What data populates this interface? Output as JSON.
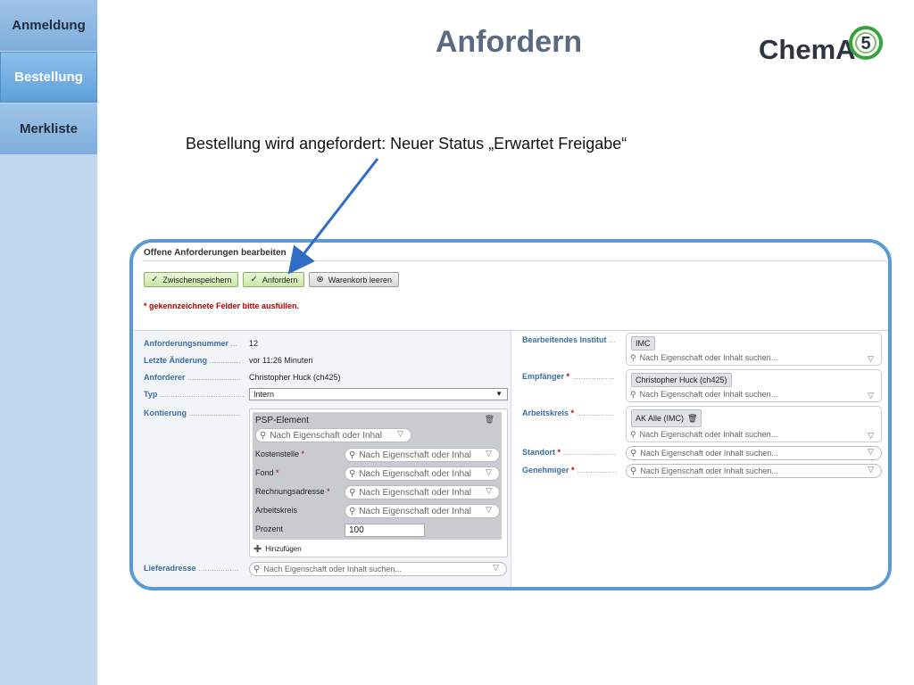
{
  "nav": {
    "items": [
      {
        "label": "Anmeldung"
      },
      {
        "label": "Bestellung"
      },
      {
        "label": "Merkliste"
      }
    ]
  },
  "slide": {
    "title": "Anfordern",
    "logo_text": "ChemA",
    "logo_number": "5",
    "caption": "Bestellung wird angefordert: Neuer Status „Erwartet Freigabe“"
  },
  "panel": {
    "title": "Offene Anforderungen bearbeiten",
    "buttons": {
      "save": "Zwischenspeichern",
      "request": "Anfordern",
      "clear_cart": "Warenkorb leeren"
    },
    "required_note": "* gekennzeichnete Felder bitte ausfüllen.",
    "left": {
      "number_label": "Anforderungsnummer",
      "number_value": "12",
      "changed_label": "Letzte Änderung",
      "changed_value": "vor 11:26 Minuten",
      "requester_label": "Anforderer",
      "requester_value": "Christopher Huck (ch425)",
      "type_label": "Typ",
      "type_value": "Intern",
      "kontierung_label": "Kontierung",
      "kontierung": {
        "psp_label": "PSP-Element",
        "kostenstelle_label": "Kostenstelle",
        "fond_label": "Fond",
        "rechnungsadresse_label": "Rechnungsadresse",
        "arbeitskreis_label": "Arbeitskreis",
        "prozent_label": "Prozent",
        "prozent_value": "100",
        "search_placeholder": "Nach Eigenschaft oder Inhal",
        "add_label": "Hinzufügen"
      },
      "delivery_label": "Lieferadresse",
      "delivery_placeholder": "Nach Eigenschaft oder Inhalt suchen..."
    },
    "right": {
      "institute_label": "Bearbeitendes Institut",
      "institute_tag": "IMC",
      "recipient_label": "Empfänger",
      "recipient_tag": "Christopher Huck (ch425)",
      "workgroup_label": "Arbeitskreis",
      "workgroup_tag": "AK Alle (IMC)",
      "location_label": "Standort",
      "approver_label": "Genehmiger",
      "search_placeholder": "Nach Eigenschaft oder Inhalt suchen..."
    }
  },
  "colors": {
    "frame": "#5b9bd5",
    "nav_active": "#5e9fda",
    "label_blue": "#3a6ea5",
    "required_red": "#b00000"
  },
  "icons": [
    "check-icon",
    "cart-clear-icon",
    "search-icon",
    "filter-icon",
    "add-icon",
    "tag-icon",
    "arrow-annotation"
  ]
}
